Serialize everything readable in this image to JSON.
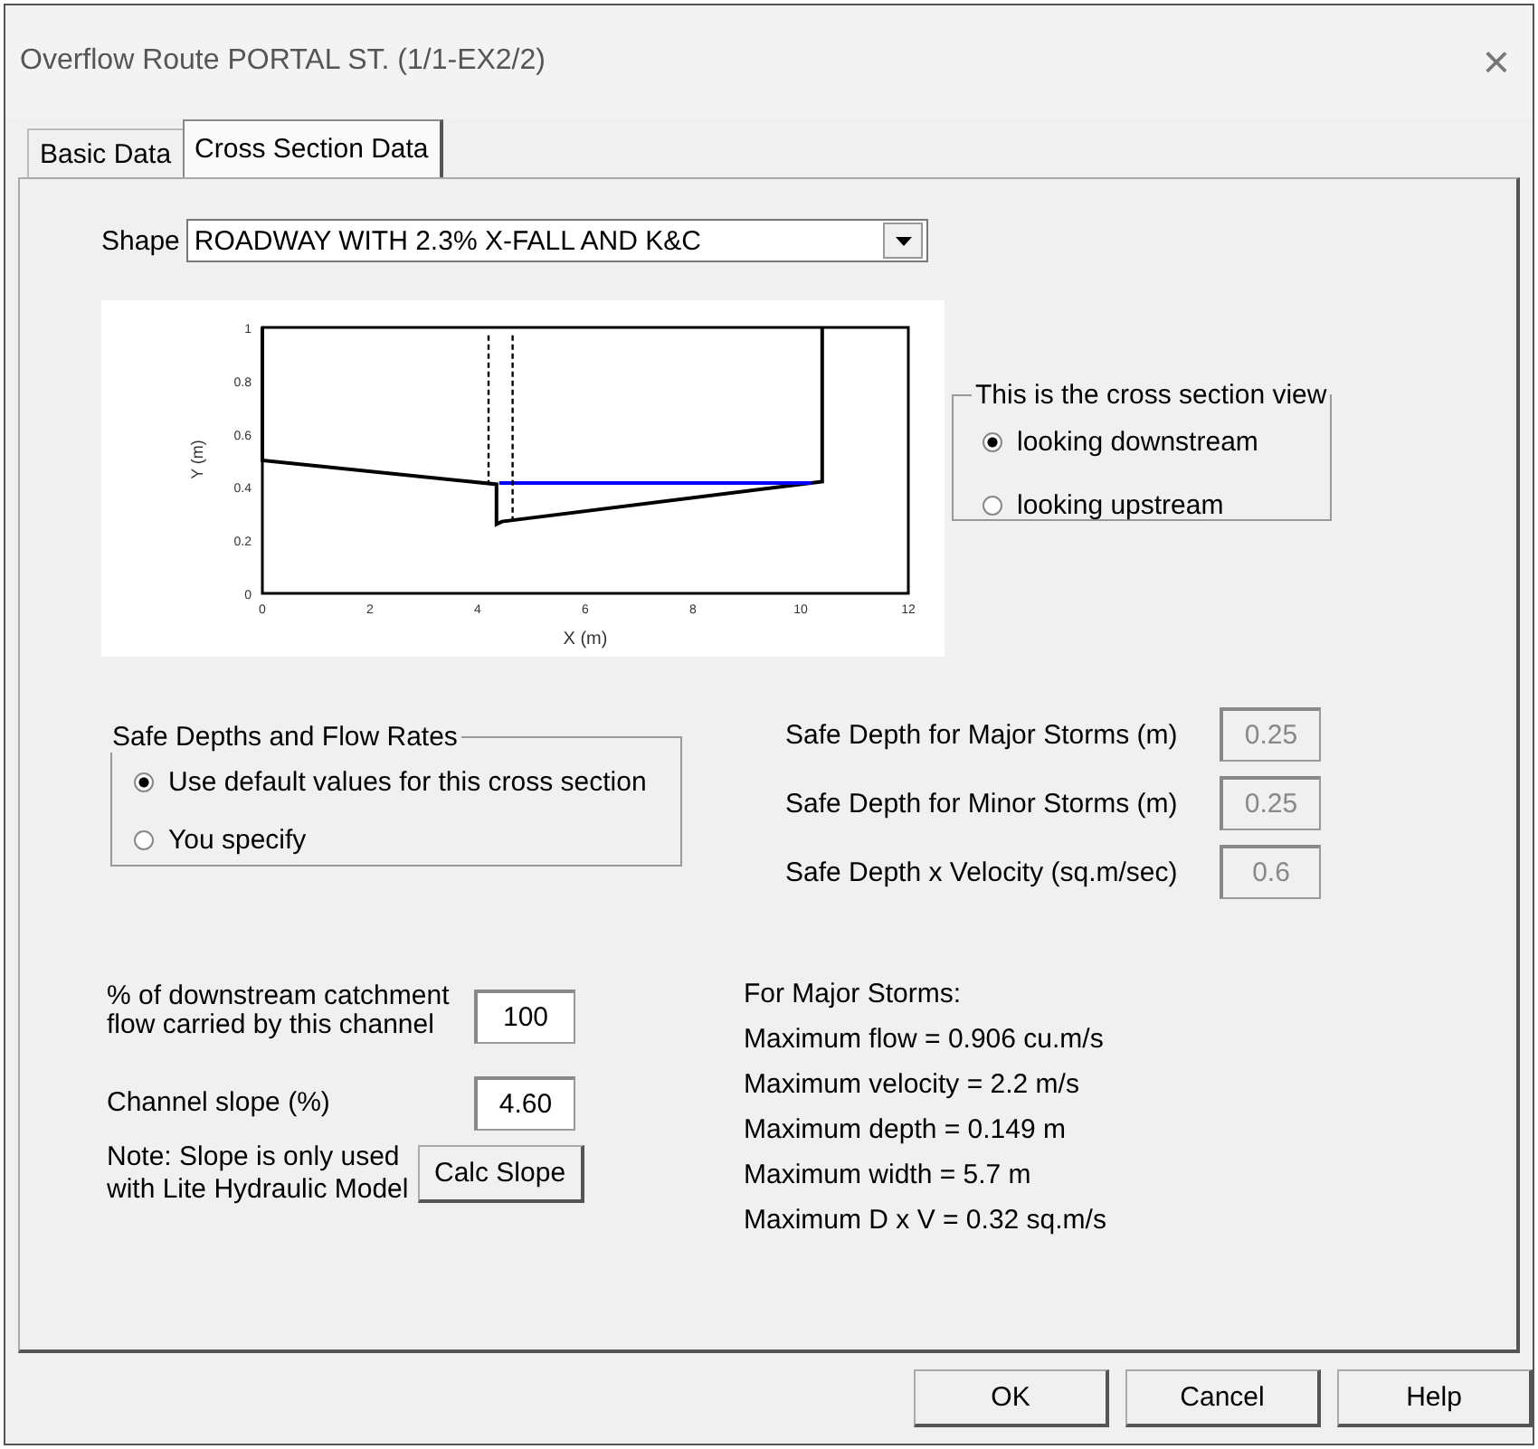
{
  "window": {
    "title": "Overflow Route PORTAL ST. (1/1-EX2/2)",
    "close": "×"
  },
  "tabs": [
    {
      "label": "Basic Data",
      "selected": false
    },
    {
      "label": "Cross Section Data",
      "selected": true
    }
  ],
  "shape": {
    "label": "Shape",
    "value": "ROADWAY WITH 2.3% X-FALL AND K&C"
  },
  "chart_data": {
    "type": "line",
    "xlabel": "X (m)",
    "ylabel": "Y (m)",
    "xlim": [
      0,
      12
    ],
    "ylim": [
      0,
      1
    ],
    "xticks": [
      0,
      2,
      4,
      6,
      8,
      10,
      12
    ],
    "yticks": [
      0,
      0.2,
      0.4,
      0.6,
      0.8,
      1
    ],
    "series": [
      {
        "color": "#000000",
        "line_style": "solid",
        "x": [
          0,
          0,
          4.35,
          4.35,
          4.45,
          10.4,
          10.4
        ],
        "values": [
          1,
          0.5,
          0.41,
          0.26,
          0.27,
          0.42,
          1
        ]
      },
      {
        "color": "#0000ff",
        "line_style": "solid",
        "x": [
          4.4,
          10.2
        ],
        "values": [
          0.415,
          0.415
        ]
      },
      {
        "color": "#000000",
        "line_style": "dashed",
        "x": [
          4.2,
          4.2
        ],
        "values": [
          0.97,
          0.41
        ]
      },
      {
        "color": "#000000",
        "line_style": "dashed",
        "x": [
          4.65,
          4.65
        ],
        "values": [
          0.97,
          0.28
        ]
      }
    ]
  },
  "view_group": {
    "title": "This is the cross section view",
    "options": [
      {
        "label": "looking downstream",
        "selected": true
      },
      {
        "label": "looking upstream",
        "selected": false
      }
    ]
  },
  "safe_group": {
    "title": "Safe Depths and Flow Rates",
    "options": [
      {
        "label": "Use default values for this cross section",
        "selected": true
      },
      {
        "label": "You specify",
        "selected": false
      }
    ]
  },
  "safe_fields": [
    {
      "label": "Safe Depth for Major Storms (m)",
      "value": "0.25",
      "disabled": true
    },
    {
      "label": "Safe Depth for Minor Storms (m)",
      "value": "0.25",
      "disabled": true
    },
    {
      "label": "Safe Depth x Velocity (sq.m/sec)",
      "value": "0.6",
      "disabled": true
    }
  ],
  "flow_share": {
    "label": "% of downstream catchment flow carried by this channel",
    "value": "100"
  },
  "slope": {
    "label": "Channel slope (%)",
    "value": "4.60"
  },
  "note": "Note:  Slope is only used with Lite Hydraulic Model",
  "calc_button": "Calc Slope",
  "results": {
    "title": "For Major Storms:",
    "lines": [
      "Maximum flow = 0.906 cu.m/s",
      "Maximum velocity = 2.2 m/s",
      "Maximum depth = 0.149 m",
      "Maximum width = 5.7 m",
      "Maximum D x V = 0.32 sq.m/s"
    ]
  },
  "buttons": [
    "OK",
    "Cancel",
    "Help"
  ]
}
